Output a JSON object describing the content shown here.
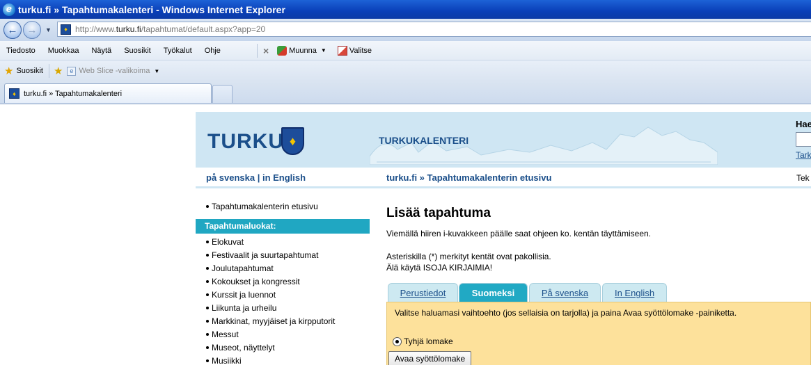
{
  "window": {
    "title": "turku.fi » Tapahtumakalenteri - Windows Internet Explorer"
  },
  "address": {
    "prefix": "http://www.",
    "domain": "turku.fi",
    "path": "/tapahtumat/default.aspx?app=20"
  },
  "menu": {
    "items": [
      "Tiedosto",
      "Muokkaa",
      "Näytä",
      "Suosikit",
      "Työkalut",
      "Ohje"
    ]
  },
  "toolbar": {
    "muunna": "Muunna",
    "valitse": "Valitse"
  },
  "favorites": {
    "label": "Suosikit",
    "webslice": "Web Slice -valikoima"
  },
  "tab": {
    "title": "turku.fi » Tapahtumakalenteri"
  },
  "header": {
    "logo_text": "TURKU",
    "calendar_title": "TURKUKALENTERI",
    "search_label": "Hae",
    "search_link": "Tark"
  },
  "nav": {
    "languages": "på svenska | in English",
    "breadcrumb": "turku.fi » Tapahtumakalenterin etusivu",
    "right_link": "Tek"
  },
  "sidebar": {
    "home_link": "Tapahtumakalenterin etusivu",
    "heading": "Tapahtumaluokat:",
    "categories": [
      "Elokuvat",
      "Festivaalit ja suurtapahtumat",
      "Joulutapahtumat",
      "Kokoukset ja kongressit",
      "Kurssit ja luennot",
      "Liikunta ja urheilu",
      "Markkinat, myyjäiset ja kirpputorit",
      "Messut",
      "Museot, näyttelyt",
      "Musiikki"
    ]
  },
  "main": {
    "heading": "Lisää tapahtuma",
    "help_text": "Viemällä hiiren i-kuvakkeen päälle saat ohjeen ko. kentän täyttämiseen.",
    "required_note": "Asteriskilla (*) merkityt kentät ovat pakollisia.",
    "caps_note": "Älä käytä ISOJA KIRJAIMIA!"
  },
  "form_tabs": [
    "Perustiedot",
    "Suomeksi",
    "På svenska",
    "In English"
  ],
  "form": {
    "instructions": "Valitse haluamasi vaihtoehto (jos sellaisia on tarjolla) ja paina Avaa syöttölomake -painiketta.",
    "radio_label": "Tyhjä lomake",
    "open_button": "Avaa syöttölomake"
  },
  "colors": {
    "header_bg": "#cfe6f3",
    "accent": "#21a9c4",
    "form_bg": "#fde19b",
    "link": "#1b4f8a"
  }
}
